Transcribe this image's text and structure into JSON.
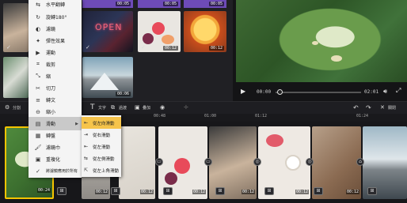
{
  "library": {
    "durations": [
      "00:05",
      "00:05",
      "00:05",
      "00:12",
      "00:12",
      "00:06",
      "00:12"
    ],
    "top_bar_color": "#6e4bb8"
  },
  "preview": {
    "current_time": "00:00",
    "total_time": "02:01"
  },
  "toolbar": {
    "items": [
      "分割",
      "分離",
      "文字",
      "過渡",
      "疊加",
      "關閉"
    ]
  },
  "ruler": {
    "ticks": [
      "00:48",
      "01:00",
      "01:12",
      "01:24"
    ]
  },
  "clips": {
    "durations": [
      "00:24",
      "00:12",
      "00:12",
      "00:12",
      "00:12",
      "00:12",
      "00:12"
    ]
  },
  "menu": {
    "items": [
      {
        "label": "水平翻轉",
        "icon": "flip-icon"
      },
      {
        "label": "旋轉180°",
        "icon": "rotate-icon"
      },
      {
        "label": "濾鏡",
        "icon": "filter-icon"
      },
      {
        "label": "彈性效果",
        "icon": "effect-icon"
      },
      {
        "label": "運動",
        "icon": "motion-icon"
      },
      {
        "label": "裁剪",
        "icon": "crop-icon"
      },
      {
        "label": "縮",
        "icon": "scale-icon"
      },
      {
        "label": "切刀",
        "icon": "cut-icon"
      },
      {
        "label": "轉文",
        "icon": "text-icon"
      },
      {
        "label": "縮小",
        "icon": "shrink-icon"
      },
      {
        "label": "滑動",
        "icon": "slide-icon"
      },
      {
        "label": "轉盤",
        "icon": "wheel-icon"
      },
      {
        "label": "濾鏡巾",
        "icon": "filter2-icon"
      },
      {
        "label": "重複化",
        "icon": "repeat-icon"
      },
      {
        "label": "將濾鏡應用於所有",
        "icon": "check-icon"
      }
    ]
  },
  "submenu": {
    "items": [
      "從左向滑動",
      "從右滑動",
      "從左滑動",
      "從左側滑動",
      "從左上角滑動"
    ]
  }
}
